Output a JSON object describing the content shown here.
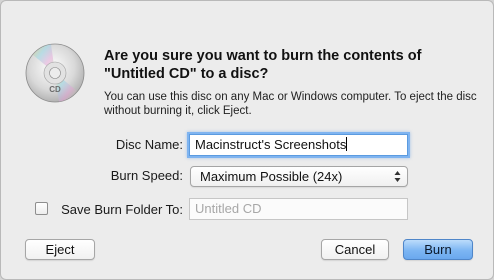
{
  "dialog": {
    "title": "Are you sure you want to burn the contents of\n\"Untitled CD\" to a disc?",
    "info": "You can use this disc on any Mac or Windows computer. To eject the disc without burning it, click Eject.",
    "icon": "cd-disc-icon",
    "icon_label": "CD"
  },
  "form": {
    "disc_name_label": "Disc Name:",
    "disc_name_value": "Macinstruct's Screenshots",
    "burn_speed_label": "Burn Speed:",
    "burn_speed_value": "Maximum Possible (24x)",
    "save_folder_label": "Save Burn Folder To:",
    "save_folder_checked": false,
    "save_folder_placeholder": "Untitled CD"
  },
  "buttons": {
    "eject": "Eject",
    "cancel": "Cancel",
    "burn": "Burn"
  },
  "colors": {
    "default_button": "#6aa8ee",
    "focus_ring": "#7fb4f0",
    "dialog_background": "#ececec"
  }
}
